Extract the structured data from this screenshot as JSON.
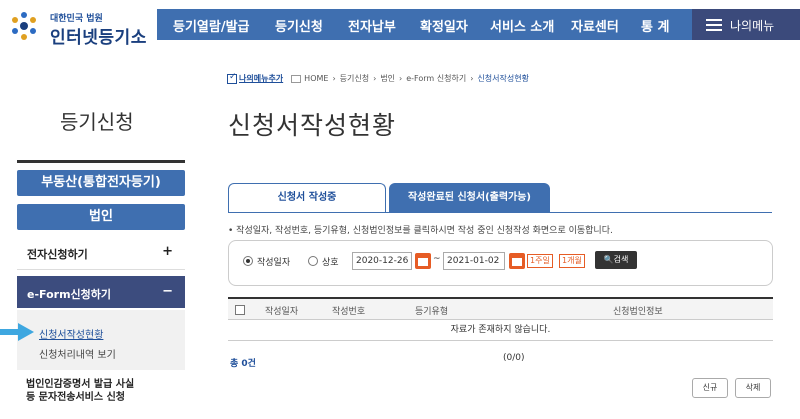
{
  "logo": {
    "sub": "대한민국 법원",
    "main": "인터넷등기소"
  },
  "gnb": {
    "items": [
      "등기열람/발급",
      "등기신청",
      "전자납부",
      "확정일자",
      "서비스 소개",
      "자료센터",
      "통 계"
    ],
    "my_menu": "나의메뉴"
  },
  "left": {
    "title": "등기신청",
    "btn_realestate": "부동산(통합전자등기)",
    "btn_corp": "법인",
    "elec_apply": "전자신청하기",
    "elec_apply_sign": "+",
    "eform_apply": "e-Form신청하기",
    "eform_apply_sign": "−",
    "sub_status": "신청서작성현황",
    "sub_history": "신청처리내역 보기",
    "corp_seal_1": "법인인감증명서 발급 사실",
    "corp_seal_2": "등 문자전송서비스 신청"
  },
  "breadcrumb": {
    "add_menu": "나의메뉴추가",
    "home": "HOME",
    "c1": "등기신청",
    "c2": "법인",
    "c3": "e-Form 신청하기",
    "current": "신청서작성현황"
  },
  "page_title": "신청서작성현황",
  "tabs": {
    "tab1": "신청서 작성중",
    "tab2": "작성완료된 신청서(출력가능)"
  },
  "notice": "• 작성일자, 작성번호, 등기유형, 신청법인정보를 클릭하시면 작성 중인 신청작성 화면으로 이동합니다.",
  "search": {
    "radio_date": "작성일자",
    "radio_name": "상호",
    "date_from": "2020-12-26",
    "date_to": "2021-01-02",
    "tilde": "~",
    "week_btn": "1주일",
    "month_btn": "1개월",
    "search_btn": "검색"
  },
  "table": {
    "headers": [
      "작성일자",
      "작성번호",
      "등기유형",
      "신청법인정보"
    ],
    "empty": "자료가 존재하지 않습니다."
  },
  "count": "총 0건",
  "pager": "(0/0)",
  "buttons": {
    "new": "신규",
    "delete": "삭제"
  }
}
